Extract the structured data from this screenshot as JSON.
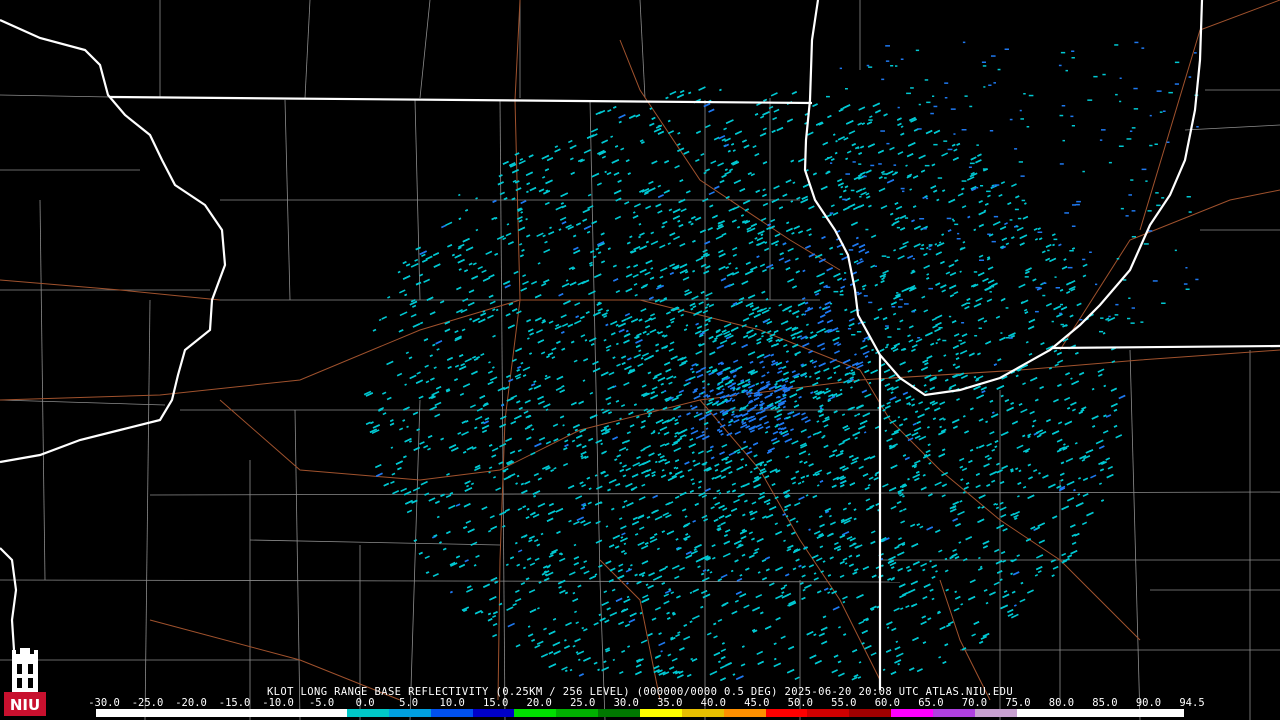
{
  "caption": "KLOT LONG RANGE BASE REFLECTIVITY (0.25KM / 256 LEVEL) (000000/0000 0.5 DEG) 2025-06-20 20:08 UTC  ATLAS.NIU.EDU",
  "logo": {
    "text": "NIU",
    "icon": "niu-tower-logo-icon"
  },
  "legend": {
    "ticks": [
      "-30.0",
      "-25.0",
      "-20.0",
      "-15.0",
      "-10.0",
      "-5.0",
      "0.0",
      "5.0",
      "10.0",
      "15.0",
      "20.0",
      "25.0",
      "30.0",
      "35.0",
      "40.0",
      "45.0",
      "50.0",
      "55.0",
      "60.0",
      "65.0",
      "70.0",
      "75.0",
      "80.0",
      "85.0",
      "90.0",
      "94.5"
    ],
    "colors": [
      "#ffffff",
      "#ffffff",
      "#ffffff",
      "#ffffff",
      "#ffffff",
      "#ffffff",
      "#00c8c8",
      "#00a0e0",
      "#0050f0",
      "#0000c8",
      "#00e000",
      "#00b000",
      "#007800",
      "#ffff00",
      "#e8c000",
      "#ff9000",
      "#ff0000",
      "#d00000",
      "#a00000",
      "#ff00ff",
      "#b040e0",
      "#c8a0d0",
      "#ffffff",
      "#ffffff",
      "#ffffff",
      "#ffffff"
    ]
  },
  "colors": {
    "background": "#000000",
    "state_border": "#ffffff",
    "county_line": "#8c8c8c",
    "road": "#a0522d",
    "echo_light": "#00c8d2",
    "echo_medium": "#1e78f0"
  }
}
